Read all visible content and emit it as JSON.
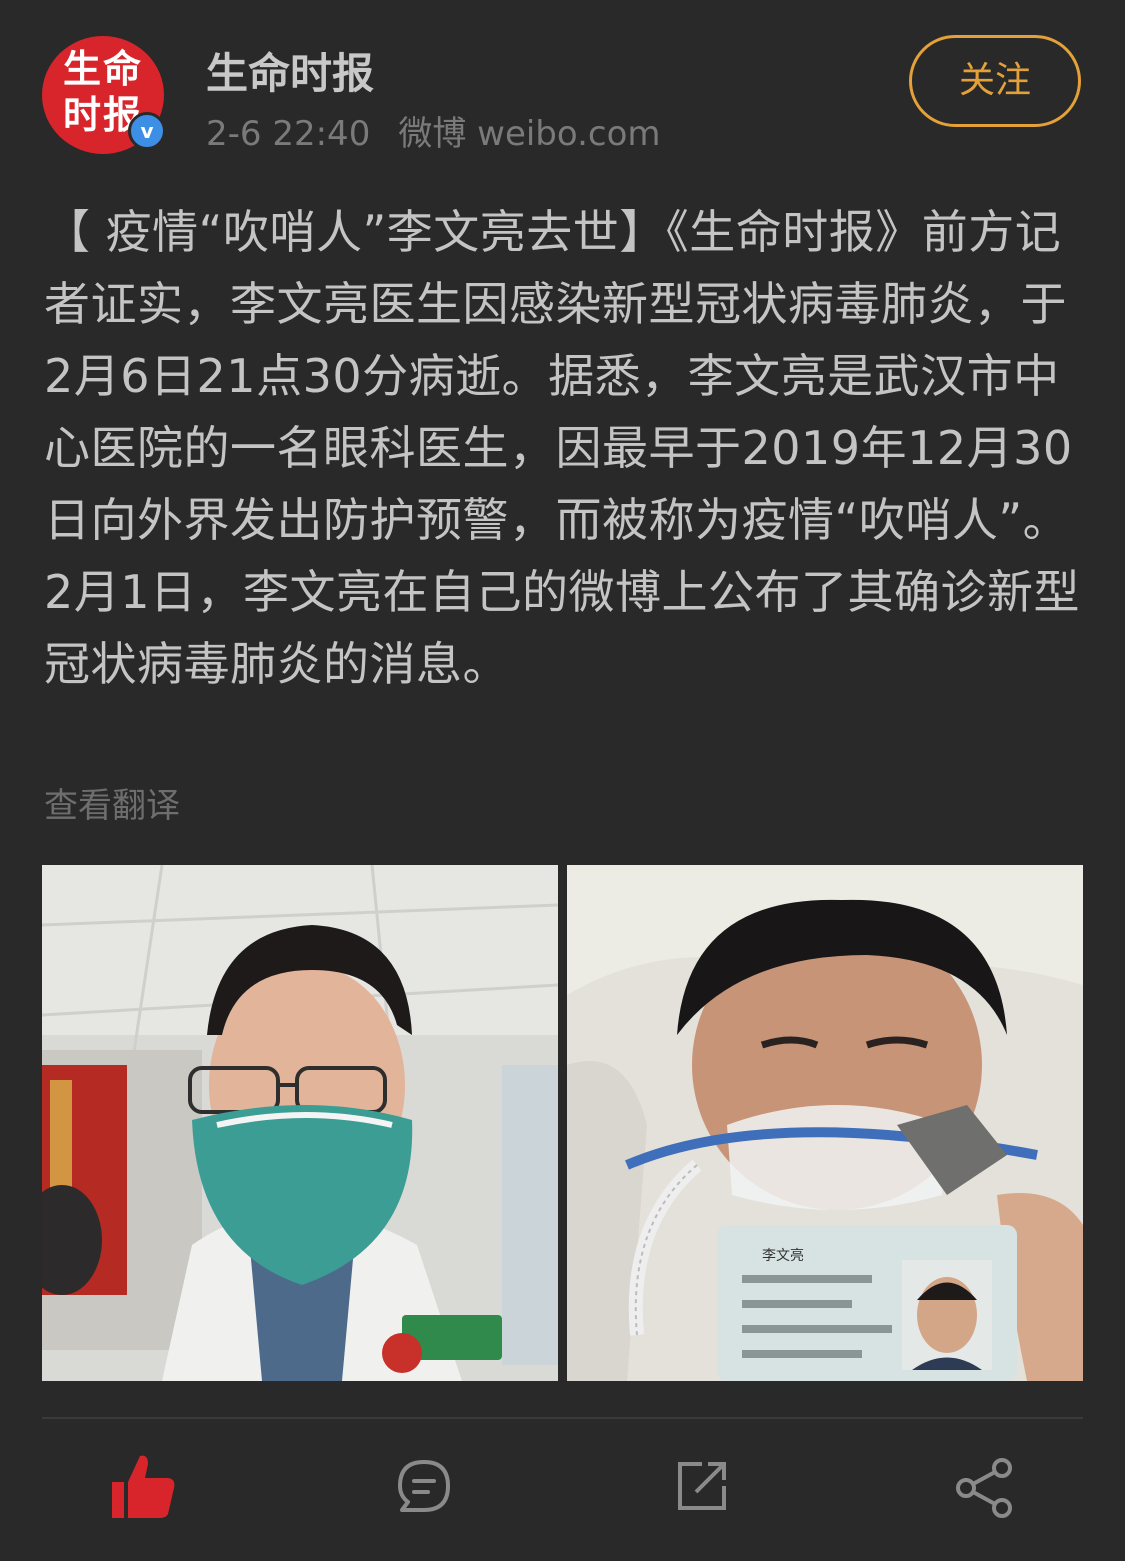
{
  "account": {
    "avatar_text": "生命时报",
    "name": "生命时报",
    "verified_mark": "v",
    "time": "2-6 22:40",
    "source": "微博 weibo.com"
  },
  "follow_label": "关注",
  "post": {
    "text": "【 疫情“吹哨人”李文亮去世】《生命时报》前方记者证实，李文亮医生因感染新型冠状病毒肺炎，于2月6日21点30分病逝。据悉，李文亮是武汉市中心医院的一名眼科医生，因最早于2019年12月30日向外界发出防护预警，而被称为疫情“吹哨人”。2月1日，李文亮在自己的微博上公布了其确诊新型冠状病毒肺炎的消息。",
    "translate_label": "查看翻译"
  },
  "photos": [
    {
      "icon": "masked-doctor-photo"
    },
    {
      "icon": "patient-with-oxygen-mask-photo",
      "id_card_name": "李文亮"
    }
  ],
  "actions": [
    {
      "icon": "thumbs-up-icon",
      "color": "#d7252b"
    },
    {
      "icon": "comment-icon",
      "color": "#8a8a8a"
    },
    {
      "icon": "repost-icon",
      "color": "#8a8a8a"
    },
    {
      "icon": "share-icon",
      "color": "#8a8a8a"
    }
  ],
  "colors": {
    "background": "#292929",
    "accent": "#e4a13a",
    "brand_red": "#d7252b",
    "text": "#c4c4c4",
    "muted": "#7a7a7a"
  }
}
